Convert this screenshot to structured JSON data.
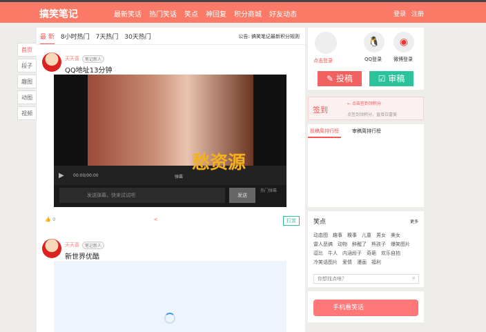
{
  "header": {
    "logo": "搞笑笔记",
    "nav": [
      "最新笑话",
      "热门笑话",
      "笑点",
      "神回复",
      "积分商城",
      "好友动态"
    ],
    "login": "登录",
    "register": "注册"
  },
  "leftnav": [
    "首页",
    "段子",
    "趣图",
    "动图",
    "视频"
  ],
  "tabs": [
    "最 新",
    "8小时热门",
    "7天热门",
    "30天热门"
  ],
  "notice": "公告: 搞笑笔记最新积分规则",
  "posts": [
    {
      "user": "天天喜",
      "badge": "笔记新人",
      "title": "QQ地址13分钟",
      "time": "00:00/00:00",
      "danmu_btn": "弹幕",
      "danmu_placeholder": "发送弹幕，快来试试吧",
      "send": "发送",
      "hot_danmu": "热门弹幕",
      "likes": "0",
      "reward": "打赏"
    },
    {
      "user": "天天喜",
      "badge": "笔记新人",
      "title": "新世界优酷"
    }
  ],
  "watermark": "愁资源",
  "sidebar": {
    "login_click": "点击登录",
    "qq_login": "QQ登录",
    "weibo_login": "微博登录",
    "submit": "投稿",
    "review": "审稿",
    "checkin": "签到",
    "checkin_hint": "← 点击签到领积分",
    "checkin_desc": "点签到领积分，直接白富美",
    "rank_tabs": [
      "投稿周排行榜",
      "审稿周排行榜"
    ],
    "tags_title": "笑点",
    "more": "更多",
    "tags": [
      "动态图",
      "趣事",
      "糗事",
      "儿童",
      "男女",
      "美女",
      "雷人恶搞",
      "动物",
      "醉醒了",
      "熊孩子",
      "爆笑图片",
      "逗比",
      "牛人",
      "内涵段子",
      "奇葩",
      "欢乐自拍",
      "冷笑话图片",
      "爱情",
      "漫画",
      "福利"
    ],
    "search_placeholder": "你想找点啥？",
    "mobile": "手机看笑话"
  },
  "colors": {
    "brand": "#fb7a67",
    "submit": "#f36060",
    "review": "#2bc39b"
  }
}
